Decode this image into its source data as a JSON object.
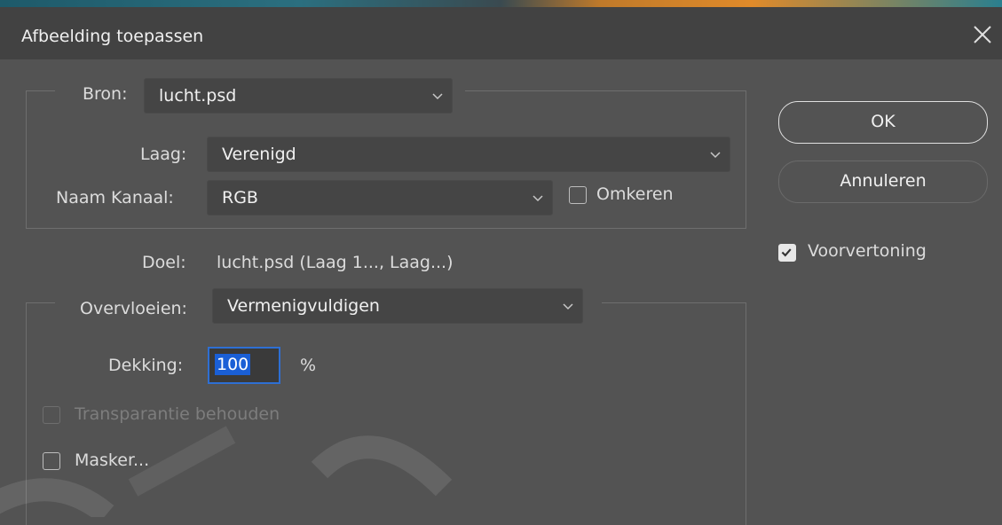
{
  "window": {
    "title": "Afbeelding toepassen",
    "close_icon": "close-icon"
  },
  "source": {
    "label": "Bron:",
    "value": "lucht.psd",
    "layer_label": "Laag:",
    "layer_value": "Verenigd",
    "channel_label": "Naam Kanaal:",
    "channel_value": "RGB",
    "invert_label": "Omkeren",
    "invert_checked": false
  },
  "target": {
    "label": "Doel:",
    "value": "lucht.psd (Laag 1..., Laag...)"
  },
  "blending": {
    "label": "Overvloeien:",
    "value": "Vermenigvuldigen",
    "opacity_label": "Dekking:",
    "opacity_value": "100",
    "opacity_unit": "%",
    "preserve_label": "Transparantie behouden",
    "preserve_checked": false,
    "preserve_disabled": true,
    "mask_label": "Masker...",
    "mask_checked": false
  },
  "buttons": {
    "ok": "OK",
    "cancel": "Annuleren"
  },
  "preview": {
    "label": "Voorvertoning",
    "checked": true
  },
  "colors": {
    "accent": "#2e6fd3",
    "selection": "#1a5fd6",
    "background": "#535353",
    "titlebar": "#424242"
  }
}
